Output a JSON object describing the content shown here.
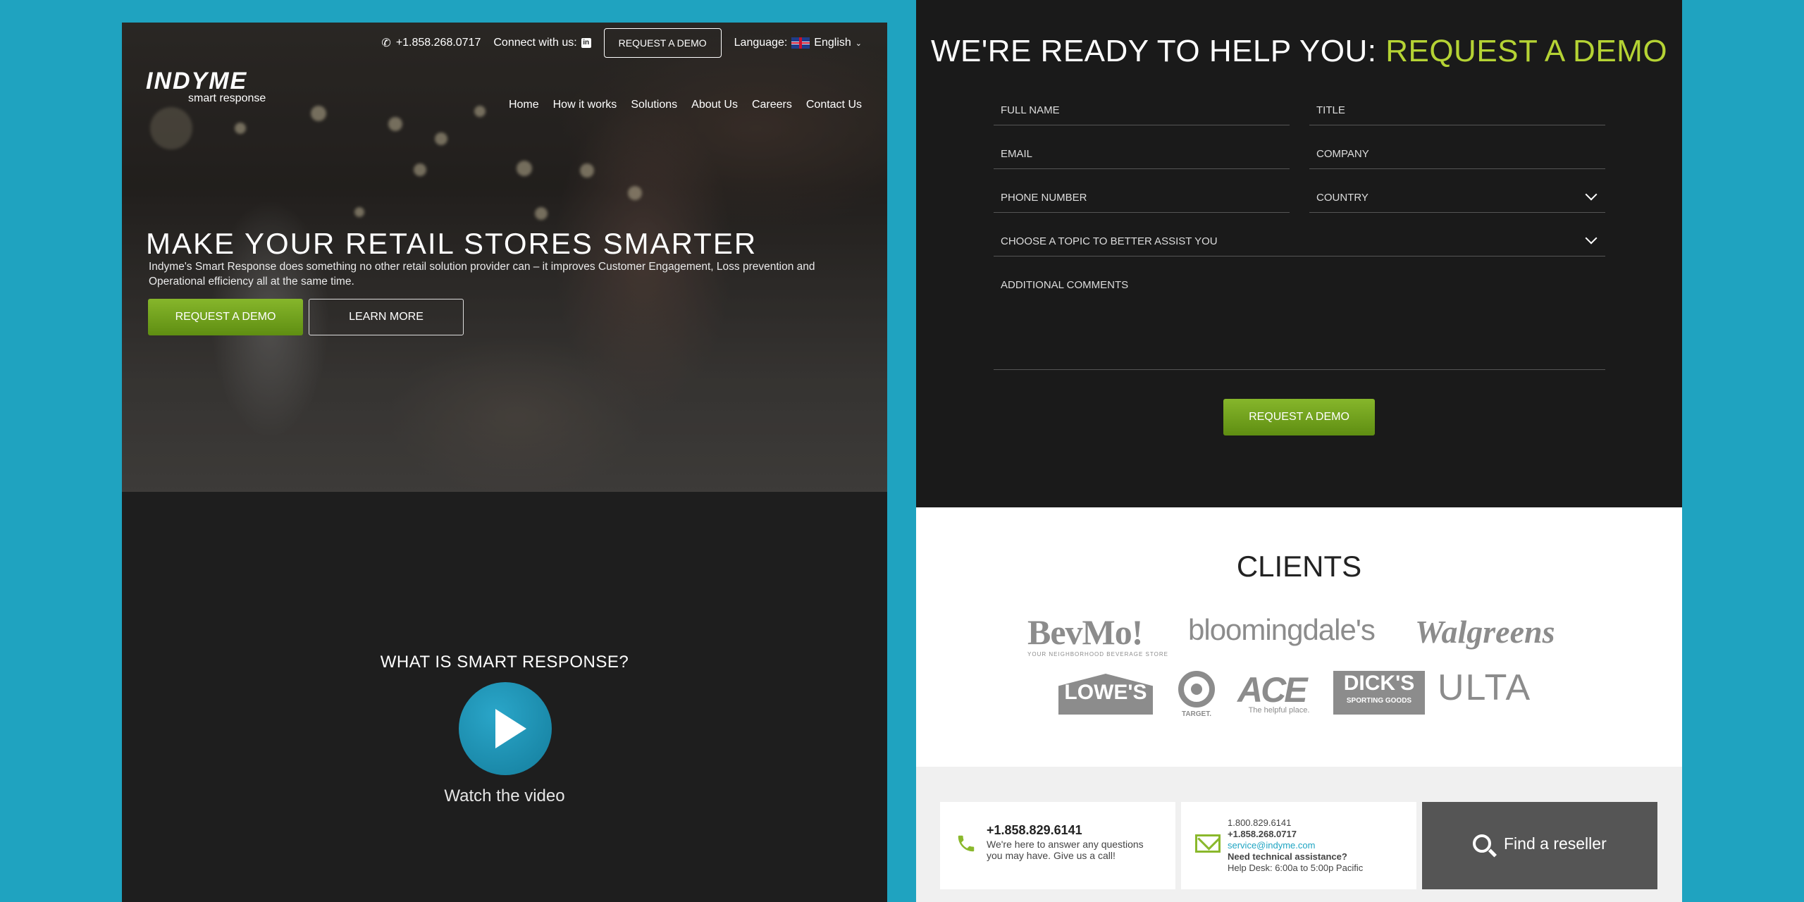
{
  "header": {
    "phone": "+1.858.268.0717",
    "connect_label": "Connect with us:",
    "demo_button": "REQUEST A DEMO",
    "language_label": "Language:",
    "language_value": "English"
  },
  "logo": {
    "name": "INDYME",
    "tagline": "smart response"
  },
  "nav": [
    "Home",
    "How it works",
    "Solutions",
    "About Us",
    "Careers",
    "Contact Us"
  ],
  "hero": {
    "title": "MAKE YOUR RETAIL STORES SMARTER",
    "text": "Indyme's Smart Response does something no other retail solution provider can – it improves Customer Engagement, Loss prevention and Operational efficiency all at the same time.",
    "demo_button": "REQUEST A DEMO",
    "learn_button": "LEARN MORE"
  },
  "video": {
    "title": "WHAT IS SMART RESPONSE?",
    "caption": "Watch the video"
  },
  "form": {
    "title_main": "WE'RE READY TO HELP YOU: ",
    "title_accent": "REQUEST A DEMO",
    "fields": {
      "full_name": "FULL NAME",
      "title": "TITLE",
      "email": "EMAIL",
      "company": "COMPANY",
      "phone": "PHONE NUMBER",
      "country": "COUNTRY",
      "topic": "CHOOSE A TOPIC TO BETTER ASSIST YOU",
      "comments": "ADDITIONAL COMMENTS"
    },
    "submit": "REQUEST A DEMO"
  },
  "clients": {
    "title": "CLIENTS",
    "logos": {
      "bevmo": "BevMo!",
      "bevmo_sub": "YOUR NEIGHBORHOOD BEVERAGE STORE",
      "bloomingdales": "bloomingdale's",
      "walgreens": "Walgreens",
      "lowes": "LOWE'S",
      "target": "TARGET.",
      "ace": "ACE",
      "ace_sub": "The helpful place.",
      "dicks": "DICK'S",
      "dicks_sub": "SPORTING GOODS",
      "ulta": "ULTA"
    }
  },
  "contact": {
    "phone": "+1.858.829.6141",
    "phone_text": "We're here to answer any questions you may have. Give us a call!",
    "support_phone1": "1.800.829.6141",
    "support_phone2": "+1.858.268.0717",
    "support_email": "service@indyme.com",
    "support_question": "Need technical assistance?",
    "support_hours": "Help Desk: 6:00a to 5:00p Pacific",
    "reseller": "Find a reseller"
  },
  "colors": {
    "background": "#1fa3c0",
    "accent_green": "#7aab22",
    "accent_lime": "#b5d334",
    "link_blue": "#1ea4c2"
  }
}
